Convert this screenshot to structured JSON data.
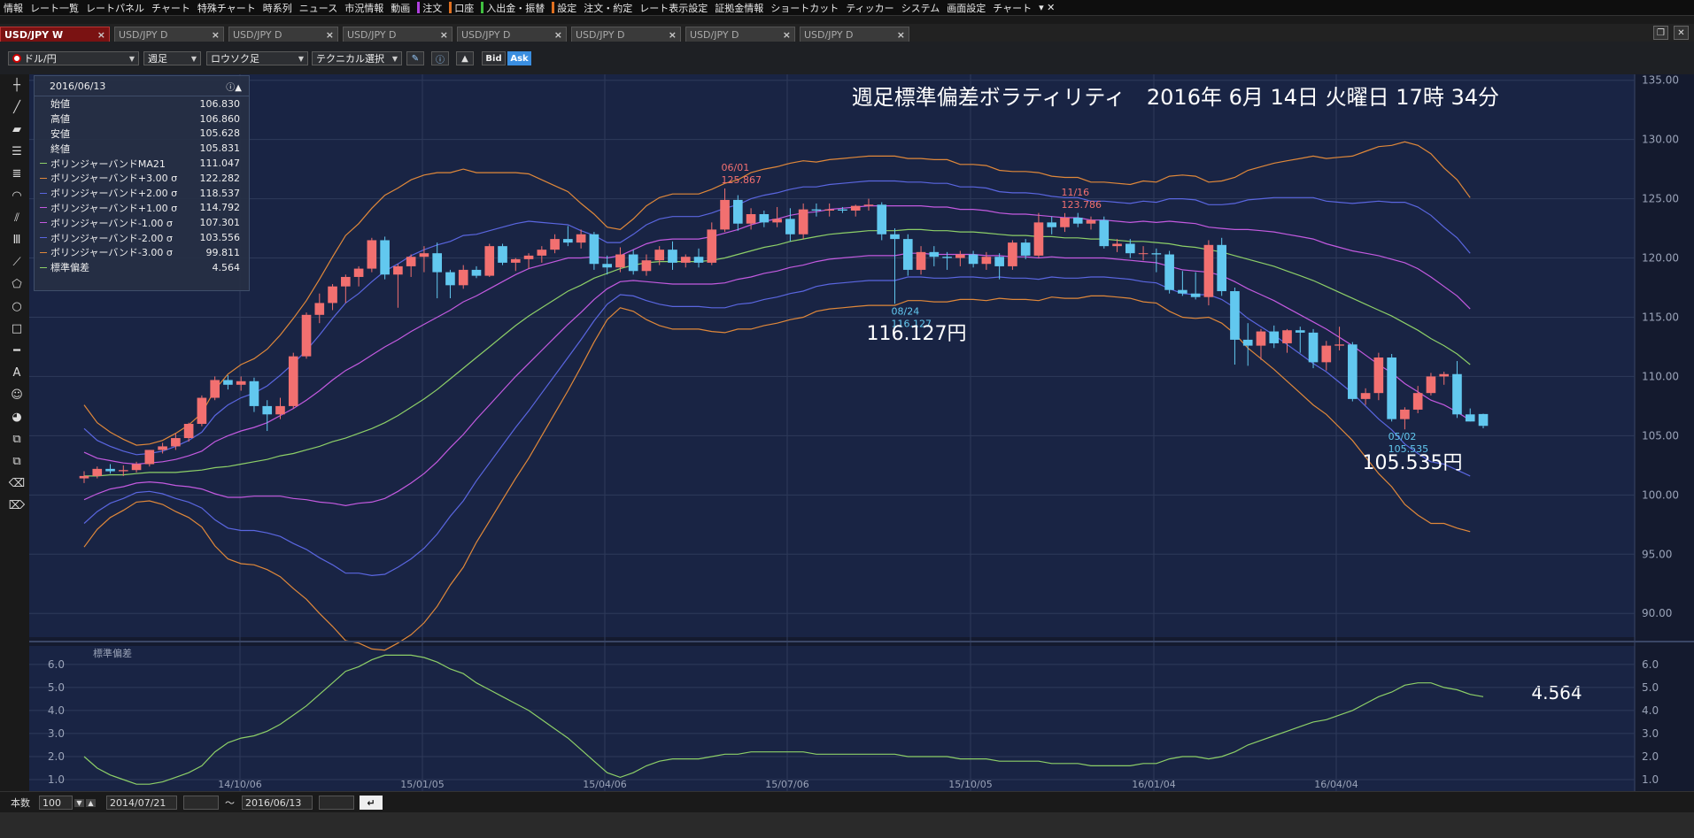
{
  "menu": [
    "情報",
    "レート一覧",
    "レートパネル",
    "チャート",
    "特殊チャート",
    "時系列",
    "ニュース",
    "市況情報",
    "動画",
    "注文",
    "口座",
    "入出金・振替",
    "設定",
    "注文・約定",
    "レート表示設定",
    "証拠金情報",
    "ショートカット",
    "ティッカー",
    "システム",
    "画面設定",
    "チャート"
  ],
  "tabs": [
    {
      "label": "USD/JPY W",
      "active": true
    },
    {
      "label": "USD/JPY D",
      "active": false
    },
    {
      "label": "USD/JPY D",
      "active": false
    },
    {
      "label": "USD/JPY D",
      "active": false
    },
    {
      "label": "USD/JPY D",
      "active": false
    },
    {
      "label": "USD/JPY D",
      "active": false
    },
    {
      "label": "USD/JPY D",
      "active": false
    },
    {
      "label": "USD/JPY D",
      "active": false
    }
  ],
  "toolbar": {
    "pair": "ドル/円",
    "period": "週足",
    "chart_type": "ロウソク足",
    "technical": "テクニカル選択",
    "bid": "Bid",
    "ask": "Ask"
  },
  "info_panel": {
    "date": "2016/06/13",
    "rows": [
      {
        "label": "始値",
        "value": "106.830",
        "color": ""
      },
      {
        "label": "高値",
        "value": "106.860",
        "color": ""
      },
      {
        "label": "安値",
        "value": "105.628",
        "color": ""
      },
      {
        "label": "終値",
        "value": "105.831",
        "color": ""
      },
      {
        "label": "ボリンジャーバンドMA21",
        "value": "111.047",
        "color": "#8dcf68"
      },
      {
        "label": "ボリンジャーバンド+3.00 σ",
        "value": "122.282",
        "color": "#e0883a"
      },
      {
        "label": "ボリンジャーバンド+2.00 σ",
        "value": "118.537",
        "color": "#5a66e0"
      },
      {
        "label": "ボリンジャーバンド+1.00 σ",
        "value": "114.792",
        "color": "#c35ae0"
      },
      {
        "label": "ボリンジャーバンド-1.00 σ",
        "value": "107.301",
        "color": "#c35ae0"
      },
      {
        "label": "ボリンジャーバンド-2.00 σ",
        "value": "103.556",
        "color": "#5a66e0"
      },
      {
        "label": "ボリンジャーバンド-3.00 σ",
        "value": "99.811",
        "color": "#e0883a"
      },
      {
        "label": "標準偏差",
        "value": "4.564",
        "color": "#8dcf68"
      }
    ]
  },
  "chart_data": {
    "type": "candlestick",
    "title": "週足標準偏差ボラティリティ　2016年 6月 14日 火曜日 17時 34分",
    "ylim": [
      88,
      135.5
    ],
    "y_ticks": [
      "135.00",
      "130.00",
      "125.00",
      "120.00",
      "115.00",
      "110.00",
      "105.00",
      "100.00",
      "95.00",
      "90.00"
    ],
    "x_ticks": [
      "14/10/06",
      "15/01/05",
      "15/04/06",
      "15/07/06",
      "15/10/05",
      "16/01/04",
      "16/04/04"
    ],
    "candles": [
      [
        101.4,
        102.0,
        101.0,
        101.6
      ],
      [
        101.6,
        102.4,
        101.4,
        102.2
      ],
      [
        102.2,
        102.6,
        101.8,
        102.0
      ],
      [
        102.0,
        102.5,
        101.6,
        102.1
      ],
      [
        102.1,
        102.8,
        101.9,
        102.6
      ],
      [
        102.6,
        103.8,
        102.4,
        103.8
      ],
      [
        103.8,
        104.4,
        103.5,
        104.1
      ],
      [
        104.1,
        105.2,
        103.8,
        104.8
      ],
      [
        104.8,
        106.1,
        104.5,
        106.0
      ],
      [
        106.0,
        108.4,
        105.8,
        108.2
      ],
      [
        108.2,
        110.0,
        108.0,
        109.7
      ],
      [
        109.7,
        110.1,
        108.9,
        109.3
      ],
      [
        109.3,
        110.0,
        108.8,
        109.6
      ],
      [
        109.6,
        109.9,
        107.0,
        107.5
      ],
      [
        107.5,
        108.0,
        105.4,
        106.8
      ],
      [
        106.8,
        108.2,
        106.4,
        107.5
      ],
      [
        107.5,
        112.0,
        107.3,
        111.7
      ],
      [
        111.7,
        115.4,
        111.5,
        115.2
      ],
      [
        115.2,
        117.0,
        114.5,
        116.2
      ],
      [
        116.2,
        117.8,
        115.6,
        117.6
      ],
      [
        117.6,
        118.6,
        116.2,
        118.4
      ],
      [
        118.4,
        119.3,
        117.6,
        119.1
      ],
      [
        119.1,
        121.7,
        118.8,
        121.5
      ],
      [
        121.5,
        121.8,
        118.2,
        118.6
      ],
      [
        118.6,
        119.5,
        115.8,
        119.3
      ],
      [
        119.3,
        120.3,
        118.4,
        120.1
      ],
      [
        120.1,
        121.0,
        118.8,
        120.4
      ],
      [
        120.4,
        121.3,
        116.6,
        118.8
      ],
      [
        118.8,
        119.0,
        116.6,
        117.7
      ],
      [
        117.7,
        119.4,
        117.4,
        119.0
      ],
      [
        119.0,
        119.3,
        118.3,
        118.5
      ],
      [
        118.5,
        121.2,
        118.4,
        121.0
      ],
      [
        121.0,
        121.2,
        119.4,
        119.6
      ],
      [
        119.6,
        120.0,
        118.9,
        119.9
      ],
      [
        119.9,
        120.4,
        119.1,
        120.2
      ],
      [
        120.2,
        121.0,
        119.6,
        120.7
      ],
      [
        120.7,
        122.0,
        120.4,
        121.6
      ],
      [
        121.6,
        122.7,
        121.0,
        121.3
      ],
      [
        121.3,
        122.4,
        120.8,
        122.0
      ],
      [
        122.0,
        122.2,
        119.0,
        119.5
      ],
      [
        119.5,
        120.2,
        118.6,
        119.2
      ],
      [
        119.2,
        120.9,
        118.8,
        120.3
      ],
      [
        120.3,
        120.7,
        118.6,
        118.9
      ],
      [
        118.9,
        120.3,
        118.5,
        119.8
      ],
      [
        119.8,
        121.0,
        119.4,
        120.7
      ],
      [
        120.7,
        121.4,
        119.0,
        119.6
      ],
      [
        119.6,
        120.3,
        119.2,
        120.1
      ],
      [
        120.1,
        120.8,
        119.2,
        119.6
      ],
      [
        119.6,
        123.0,
        119.4,
        122.4
      ],
      [
        122.4,
        125.87,
        122.2,
        124.9
      ],
      [
        124.9,
        125.3,
        122.3,
        122.9
      ],
      [
        122.9,
        124.2,
        122.4,
        123.7
      ],
      [
        123.7,
        124.0,
        122.6,
        123.0
      ],
      [
        123.0,
        124.3,
        122.6,
        123.3
      ],
      [
        123.3,
        124.2,
        121.4,
        122.0
      ],
      [
        122.0,
        124.6,
        121.6,
        124.1
      ],
      [
        124.1,
        124.6,
        123.5,
        124.0
      ],
      [
        124.0,
        124.6,
        123.5,
        124.1
      ],
      [
        124.1,
        124.3,
        123.8,
        124.0
      ],
      [
        124.0,
        124.5,
        123.5,
        124.4
      ],
      [
        124.4,
        125.0,
        124.0,
        124.5
      ],
      [
        124.5,
        124.7,
        121.5,
        122.0
      ],
      [
        122.0,
        122.5,
        116.13,
        121.6
      ],
      [
        121.6,
        122.0,
        118.5,
        119.0
      ],
      [
        119.0,
        121.0,
        118.6,
        120.5
      ],
      [
        120.5,
        121.0,
        119.3,
        120.1
      ],
      [
        120.1,
        120.5,
        119.0,
        120.0
      ],
      [
        120.0,
        120.6,
        119.3,
        120.3
      ],
      [
        120.3,
        120.6,
        119.2,
        119.5
      ],
      [
        119.5,
        120.5,
        119.0,
        120.1
      ],
      [
        120.1,
        120.4,
        118.2,
        119.3
      ],
      [
        119.3,
        121.5,
        119.0,
        121.3
      ],
      [
        121.3,
        121.6,
        119.9,
        120.2
      ],
      [
        120.2,
        123.8,
        120.0,
        123.0
      ],
      [
        123.0,
        123.5,
        122.0,
        122.6
      ],
      [
        122.6,
        123.79,
        122.2,
        123.4
      ],
      [
        123.4,
        123.8,
        122.6,
        122.9
      ],
      [
        122.9,
        123.5,
        122.4,
        123.2
      ],
      [
        123.2,
        123.5,
        120.8,
        121.0
      ],
      [
        121.0,
        121.6,
        120.5,
        121.2
      ],
      [
        121.2,
        121.6,
        120.0,
        120.4
      ],
      [
        120.4,
        121.0,
        119.8,
        120.4
      ],
      [
        120.4,
        120.8,
        118.8,
        120.3
      ],
      [
        120.3,
        120.6,
        117.0,
        117.3
      ],
      [
        117.3,
        118.9,
        116.8,
        117.0
      ],
      [
        117.0,
        118.8,
        116.5,
        116.7
      ],
      [
        116.7,
        121.5,
        116.0,
        121.1
      ],
      [
        121.1,
        121.7,
        116.8,
        117.2
      ],
      [
        117.2,
        117.5,
        111.0,
        113.1
      ],
      [
        113.1,
        114.5,
        110.9,
        112.6
      ],
      [
        112.6,
        114.0,
        111.4,
        113.8
      ],
      [
        113.8,
        114.3,
        112.4,
        112.8
      ],
      [
        112.8,
        114.0,
        112.0,
        113.9
      ],
      [
        113.9,
        114.2,
        112.0,
        113.7
      ],
      [
        113.7,
        114.0,
        110.7,
        111.2
      ],
      [
        111.2,
        113.0,
        110.5,
        112.6
      ],
      [
        112.6,
        114.2,
        112.2,
        112.7
      ],
      [
        112.7,
        112.9,
        107.9,
        108.1
      ],
      [
        108.1,
        109.0,
        107.6,
        108.6
      ],
      [
        108.6,
        112.0,
        108.0,
        111.6
      ],
      [
        111.6,
        111.9,
        106.2,
        106.4
      ],
      [
        106.4,
        107.4,
        105.535,
        107.2
      ],
      [
        107.2,
        109.2,
        106.9,
        108.6
      ],
      [
        108.6,
        110.3,
        108.4,
        110.0
      ],
      [
        110.0,
        110.4,
        109.3,
        110.2
      ],
      [
        110.2,
        111.3,
        106.5,
        106.8
      ],
      [
        106.8,
        107.3,
        106.2,
        106.2
      ],
      [
        106.83,
        106.86,
        105.628,
        105.831
      ]
    ],
    "bollinger": {
      "ma21": [
        101.6,
        101.6,
        101.7,
        101.7,
        101.8,
        101.9,
        101.9,
        101.9,
        102.0,
        102.1,
        102.3,
        102.4,
        102.6,
        102.8,
        103.0,
        103.3,
        103.5,
        103.8,
        104.1,
        104.5,
        104.8,
        105.2,
        105.6,
        106.1,
        106.7,
        107.4,
        108.1,
        108.9,
        109.8,
        110.7,
        111.6,
        112.5,
        113.4,
        114.3,
        115.1,
        115.8,
        116.5,
        117.2,
        117.7,
        118.3,
        118.7,
        119.1,
        119.4,
        119.6,
        119.7,
        119.7,
        119.7,
        119.7,
        119.8,
        120.0,
        120.3,
        120.6,
        120.9,
        121.1,
        121.4,
        121.6,
        121.8,
        122.0,
        122.1,
        122.2,
        122.3,
        122.3,
        122.3,
        122.4,
        122.4,
        122.3,
        122.3,
        122.2,
        122.2,
        122.1,
        122.0,
        121.9,
        121.9,
        121.8,
        121.8,
        121.7,
        121.7,
        121.6,
        121.6,
        121.5,
        121.4,
        121.4,
        121.3,
        121.2,
        121.0,
        120.9,
        120.7,
        120.5,
        120.2,
        119.9,
        119.6,
        119.3,
        118.9,
        118.5,
        118.1,
        117.6,
        117.1,
        116.6,
        116.1,
        115.6,
        115.1,
        114.5,
        113.9,
        113.2,
        112.6,
        111.9,
        111.0
      ],
      "s1": [
        2.0,
        1.5,
        1.2,
        1.0,
        0.8,
        0.8,
        0.9,
        1.1,
        1.3,
        1.6,
        2.2,
        2.6,
        2.8,
        2.9,
        3.1,
        3.4,
        3.8,
        4.2,
        4.7,
        5.2,
        5.7,
        5.9,
        6.2,
        6.4,
        6.4,
        6.4,
        6.3,
        6.1,
        5.8,
        5.6,
        5.2,
        4.9,
        4.6,
        4.3,
        4.0,
        3.6,
        3.2,
        2.8,
        2.3,
        1.8,
        1.3,
        1.1,
        1.3,
        1.6,
        1.8,
        1.9,
        1.9,
        1.9,
        2.0,
        2.1,
        2.1,
        2.2,
        2.2,
        2.2,
        2.2,
        2.2,
        2.1,
        2.1,
        2.1,
        2.1,
        2.1,
        2.1,
        2.1,
        2.0,
        2.0,
        2.0,
        2.0,
        1.9,
        1.9,
        1.9,
        1.8,
        1.8,
        1.8,
        1.8,
        1.7,
        1.7,
        1.7,
        1.6,
        1.6,
        1.6,
        1.6,
        1.7,
        1.7,
        1.9,
        2.0,
        2.0,
        1.9,
        2.0,
        2.2,
        2.5,
        2.7,
        2.9,
        3.1,
        3.3,
        3.5,
        3.6,
        3.8,
        4.0,
        4.3,
        4.6,
        4.8,
        5.1,
        5.2,
        5.2,
        5.0,
        4.9,
        4.7,
        4.6
      ]
    },
    "stddev": {
      "label": "標準偏差",
      "ylim": [
        0.5,
        6.8
      ],
      "y_ticks": [
        "6.0",
        "5.0",
        "4.0",
        "3.0",
        "2.0",
        "1.0"
      ],
      "last": "4.564"
    },
    "annotations": [
      {
        "date": "06/01",
        "value": "125.867"
      },
      {
        "date": "11/16",
        "value": "123.786"
      },
      {
        "date": "08/24",
        "value": "116.127"
      },
      {
        "date": "05/02",
        "value": "105.535"
      }
    ],
    "big_labels": [
      "116.127円",
      "105.535円",
      "4.564"
    ]
  },
  "status": {
    "count_label": "本数",
    "count": "100",
    "from": "2014/07/21",
    "tilde": "〜",
    "to": "2016/06/13"
  }
}
